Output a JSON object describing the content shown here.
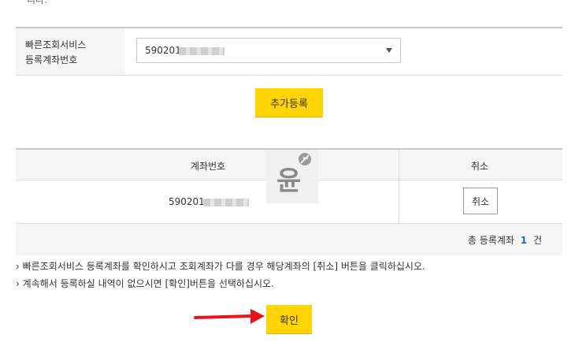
{
  "top_fragment": "니다.",
  "form": {
    "label_line1": "빠른조회서비스",
    "label_line2": "등록계좌번호",
    "selected_account_prefix": "590201-"
  },
  "add_button": "추가등록",
  "table": {
    "header_account": "계좌번호",
    "header_cancel": "취소",
    "rows": [
      {
        "account_prefix": "590201-",
        "cancel_label": "취소"
      }
    ],
    "summary_prefix": "총 등록계좌",
    "summary_count": "1",
    "summary_suffix": "건"
  },
  "watermark_char": "윤",
  "notes": [
    "› 빠른조회서비스 등록계좌를 확인하시고 조회계좌가 다를 경우 해당계좌의 [취소] 버튼을 클릭하십시오.",
    "› 계속해서 등록하실 내역이 없으시면 [확인]버튼을 선택하십시오."
  ],
  "confirm_button": "확인",
  "colors": {
    "accent_yellow": "#ffd400",
    "arrow_red": "#e8141b",
    "count_blue": "#1a6ec1"
  }
}
